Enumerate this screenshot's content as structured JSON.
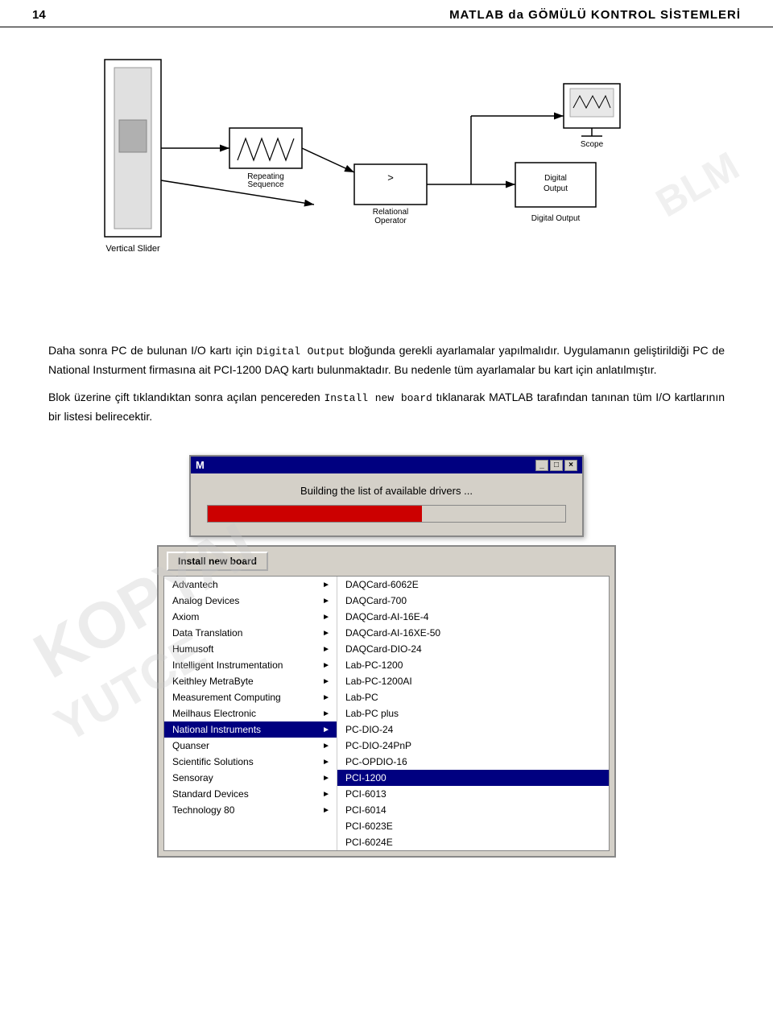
{
  "header": {
    "page_number": "14",
    "title": "MATLAB da GÖMÜLÜ KONTROL SİSTEMLERİ"
  },
  "diagram": {
    "elements": [
      {
        "id": "vertical_slider",
        "label": "Vertical Slider"
      },
      {
        "id": "repeating_sequence",
        "label": "Repeating\nSequence"
      },
      {
        "id": "relational_operator",
        "label": "Relational\nOperator"
      },
      {
        "id": "scope",
        "label": "Scope"
      },
      {
        "id": "digital_output_block",
        "label": "Digital\nOutput"
      },
      {
        "id": "digital_output_label",
        "label": "Digital Output"
      }
    ]
  },
  "text": {
    "paragraph1_pre": "Daha sonra PC de bulunan I/O kartı için ",
    "paragraph1_mono": "Digital Output",
    "paragraph1_post": " bloğunda gerekli ayarlamalar yapılmalıdır. Uygulamanın geliştirildiği PC de National Insturment firmasına ait PCI-1200 DAQ kartı bulunmaktadır. Bu nedenle tüm ayarlamalar bu kart için anlatılmıştır.",
    "paragraph2_pre": "Blok üzerine çift tıklandıktan sonra açılan pencereden ",
    "paragraph2_mono": "Install new board",
    "paragraph2_post": " tıklanarak MATLAB tarafından tanınan tüm I/O kartlarının bir listesi belirecektir."
  },
  "progress_dialog": {
    "title_icon": "M",
    "title_text": "",
    "message": "Building the list of available drivers ...",
    "progress_pct": 60,
    "btn_minimize": "_",
    "btn_maximize": "□",
    "btn_close": "×"
  },
  "install_dialog": {
    "header_btn": "Install new board",
    "left_menu_items": [
      {
        "label": "Advantech",
        "has_arrow": true,
        "selected": false
      },
      {
        "label": "Analog Devices",
        "has_arrow": true,
        "selected": false
      },
      {
        "label": "Axiom",
        "has_arrow": true,
        "selected": false
      },
      {
        "label": "Data Translation",
        "has_arrow": true,
        "selected": false
      },
      {
        "label": "Humusoft",
        "has_arrow": true,
        "selected": false
      },
      {
        "label": "Intelligent Instrumentation",
        "has_arrow": true,
        "selected": false
      },
      {
        "label": "Keithley MetraByte",
        "has_arrow": true,
        "selected": false
      },
      {
        "label": "Measurement Computing",
        "has_arrow": true,
        "selected": false
      },
      {
        "label": "Meilhaus Electronic",
        "has_arrow": true,
        "selected": false
      },
      {
        "label": "National Instruments",
        "has_arrow": true,
        "selected": true
      },
      {
        "label": "Quanser",
        "has_arrow": true,
        "selected": false
      },
      {
        "label": "Scientific Solutions",
        "has_arrow": true,
        "selected": false
      },
      {
        "label": "Sensoray",
        "has_arrow": true,
        "selected": false
      },
      {
        "label": "Standard Devices",
        "has_arrow": true,
        "selected": false
      },
      {
        "label": "Technology 80",
        "has_arrow": true,
        "selected": false
      }
    ],
    "right_menu_items": [
      {
        "label": "DAQCard-6062E",
        "selected": false
      },
      {
        "label": "DAQCard-700",
        "selected": false
      },
      {
        "label": "DAQCard-AI-16E-4",
        "selected": false
      },
      {
        "label": "DAQCard-AI-16XE-50",
        "selected": false
      },
      {
        "label": "DAQCard-DIO-24",
        "selected": false
      },
      {
        "label": "Lab-PC-1200",
        "selected": false
      },
      {
        "label": "Lab-PC-1200AI",
        "selected": false
      },
      {
        "label": "Lab-PC",
        "selected": false
      },
      {
        "label": "Lab-PC plus",
        "selected": false
      },
      {
        "label": "PC-DIO-24",
        "selected": false
      },
      {
        "label": "PC-DIO-24PnP",
        "selected": false
      },
      {
        "label": "PC-OPDIO-16",
        "selected": false
      },
      {
        "label": "PCI-1200",
        "selected": true
      },
      {
        "label": "PCI-6013",
        "selected": false
      },
      {
        "label": "PCI-6014",
        "selected": false
      },
      {
        "label": "PCI-6023E",
        "selected": false
      },
      {
        "label": "PCI-6024E",
        "selected": false
      }
    ]
  },
  "watermarks": {
    "w1": "KOPYAI",
    "w2": "YUTCE",
    "w3": "BLM"
  }
}
